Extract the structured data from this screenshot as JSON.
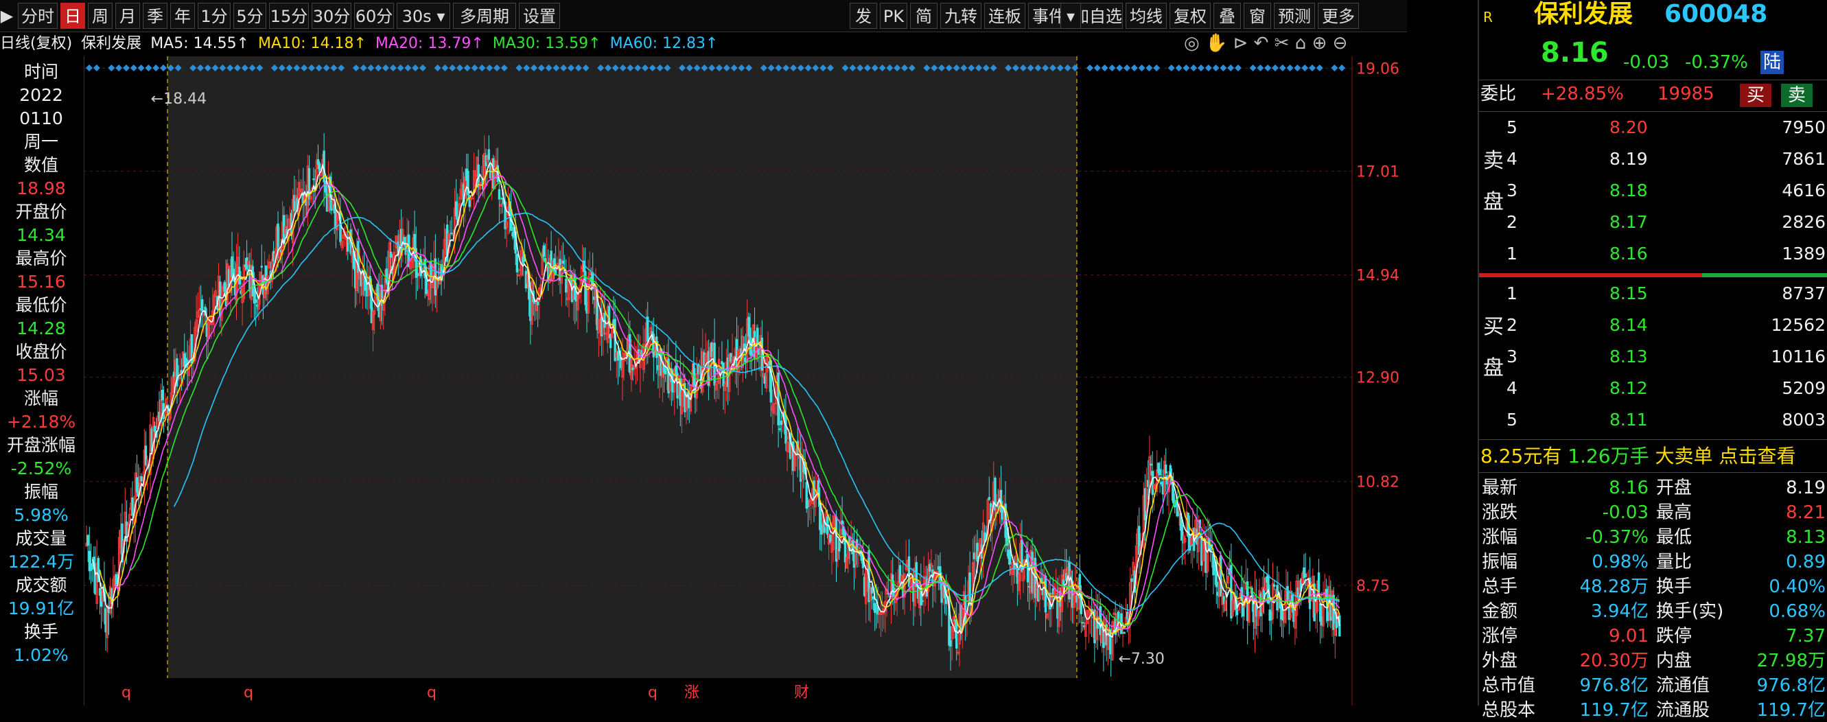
{
  "toolbar": {
    "left": [
      "分时",
      "日",
      "周",
      "月",
      "季",
      "年",
      "1分",
      "5分",
      "15分",
      "30分",
      "60分",
      "30s",
      "多周期",
      "设置"
    ],
    "active": "日",
    "right": [
      "发",
      "PK",
      "简",
      "九转",
      "连板",
      "事件",
      "加自选",
      "均线",
      "复权",
      "叠",
      "窗",
      "预测",
      "更多"
    ]
  },
  "ma_row": {
    "chart_label": "日线(复权)",
    "stock_name": "保利发展",
    "ma5": "MA5: 14.55↑",
    "ma10": "MA10: 14.18↑",
    "ma20": "MA20: 13.79↑",
    "ma30": "MA30: 13.59↑",
    "ma60": "MA60: 12.83↑"
  },
  "left_panel": [
    {
      "label": "时间",
      "value": "2022"
    },
    {
      "label": "",
      "value": "0110"
    },
    {
      "label": "周一",
      "value": ""
    },
    {
      "label": "数值",
      "value": "18.98",
      "color": "#ff3b3b"
    },
    {
      "label": "开盘价",
      "value": "14.34",
      "color": "#2ee82e"
    },
    {
      "label": "最高价",
      "value": "15.16",
      "color": "#ff3b3b"
    },
    {
      "label": "最低价",
      "value": "14.28",
      "color": "#2ee82e"
    },
    {
      "label": "收盘价",
      "value": "15.03",
      "color": "#ff3b3b"
    },
    {
      "label": "涨幅",
      "value": "+2.18%",
      "color": "#ff3b3b"
    },
    {
      "label": "开盘涨幅",
      "value": "-2.52%",
      "color": "#2ee82e"
    },
    {
      "label": "振幅",
      "value": "5.98%",
      "color": "#2ac6ff"
    },
    {
      "label": "成交量",
      "value": "122.4万",
      "color": "#2ac6ff"
    },
    {
      "label": "成交额",
      "value": "19.91亿",
      "color": "#2ac6ff"
    },
    {
      "label": "换手",
      "value": "1.02%",
      "color": "#2ac6ff"
    }
  ],
  "chart_data": {
    "type": "candlestick",
    "y_ticks": [
      "19.06",
      "17.01",
      "14.94",
      "12.90",
      "10.82",
      "8.75"
    ],
    "ylim": [
      6.9,
      19.3
    ],
    "annotations": {
      "high": "18.44",
      "low": "7.30"
    },
    "bottom_markers": [
      "q",
      "q",
      "q",
      "q",
      "涨",
      "财"
    ],
    "close_path": [
      9.6,
      8.2,
      9.8,
      11.2,
      12.4,
      13.1,
      14.0,
      14.6,
      15.0,
      14.7,
      15.8,
      16.4,
      17.2,
      15.8,
      15.0,
      14.2,
      15.6,
      15.3,
      14.8,
      16.0,
      16.8,
      17.1,
      15.8,
      14.4,
      15.3,
      14.9,
      14.6,
      13.9,
      13.3,
      13.7,
      13.0,
      12.6,
      13.2,
      12.8,
      13.7,
      13.4,
      12.2,
      11.0,
      10.1,
      9.6,
      9.2,
      8.4,
      9.0,
      8.7,
      8.9,
      7.6,
      9.0,
      10.7,
      9.3,
      9.0,
      8.3,
      8.8,
      8.0,
      7.7,
      8.2,
      10.9,
      11.0,
      9.8,
      9.4,
      8.6,
      8.4,
      8.5,
      8.3,
      8.6,
      8.4,
      8.16
    ],
    "ma_colors": {
      "ma5": "#ffffff",
      "ma10": "#ffdc00",
      "ma20": "#ff50ff",
      "ma30": "#2ee82e",
      "ma60": "#2ac6ff"
    }
  },
  "right_panel": {
    "brand_badge": "R",
    "name": "保利发展",
    "code": "600048",
    "price": "8.16",
    "change": "-0.03",
    "change_pct": "-0.37%",
    "tag": "陆",
    "weibi_label": "委比",
    "weibi_value": "+28.85%",
    "weibi_count": "19985",
    "buy_btn": "买",
    "sell_btn": "卖",
    "sell_side_label": [
      "卖",
      "盘"
    ],
    "buy_side_label": [
      "买",
      "盘"
    ],
    "asks": [
      {
        "lvl": "5",
        "price": "8.20",
        "vol": "7950",
        "color": "#ff3b3b"
      },
      {
        "lvl": "4",
        "price": "8.19",
        "vol": "7861",
        "color": "#f0f0f0"
      },
      {
        "lvl": "3",
        "price": "8.18",
        "vol": "4616",
        "color": "#2ee82e"
      },
      {
        "lvl": "2",
        "price": "8.17",
        "vol": "2826",
        "color": "#2ee82e"
      },
      {
        "lvl": "1",
        "price": "8.16",
        "vol": "1389",
        "color": "#2ee82e"
      }
    ],
    "bids": [
      {
        "lvl": "1",
        "price": "8.15",
        "vol": "8737",
        "color": "#2ee82e"
      },
      {
        "lvl": "2",
        "price": "8.14",
        "vol": "12562",
        "color": "#2ee82e"
      },
      {
        "lvl": "3",
        "price": "8.13",
        "vol": "10116",
        "color": "#2ee82e"
      },
      {
        "lvl": "4",
        "price": "8.12",
        "vol": "5209",
        "color": "#2ee82e"
      },
      {
        "lvl": "5",
        "price": "8.11",
        "vol": "8003",
        "color": "#2ee82e"
      }
    ],
    "big_order": {
      "a": "8.25元有",
      "b": "1.26万手",
      "c": "大卖单",
      "d": "点击查看"
    },
    "stats": [
      {
        "l1": "最新",
        "v1": "8.16",
        "c1": "#2ee82e",
        "l2": "开盘",
        "v2": "8.19",
        "c2": "#f0f0f0"
      },
      {
        "l1": "涨跌",
        "v1": "-0.03",
        "c1": "#2ee82e",
        "l2": "最高",
        "v2": "8.21",
        "c2": "#ff3b3b"
      },
      {
        "l1": "涨幅",
        "v1": "-0.37%",
        "c1": "#2ee82e",
        "l2": "最低",
        "v2": "8.13",
        "c2": "#2ee82e"
      },
      {
        "l1": "振幅",
        "v1": "0.98%",
        "c1": "#2ac6ff",
        "l2": "量比",
        "v2": "0.89",
        "c2": "#2ac6ff"
      },
      {
        "l1": "总手",
        "v1": "48.28万",
        "c1": "#2ac6ff",
        "l2": "换手",
        "v2": "0.40%",
        "c2": "#2ac6ff"
      },
      {
        "l1": "金额",
        "v1": "3.94亿",
        "c1": "#2ac6ff",
        "l2": "换手(实)",
        "v2": "0.68%",
        "c2": "#2ac6ff"
      },
      {
        "l1": "涨停",
        "v1": "9.01",
        "c1": "#ff3b3b",
        "l2": "跌停",
        "v2": "7.37",
        "c2": "#2ee82e"
      },
      {
        "l1": "外盘",
        "v1": "20.30万",
        "c1": "#ff3b3b",
        "l2": "内盘",
        "v2": "27.98万",
        "c2": "#2ee82e"
      },
      {
        "l1": "总市值",
        "v1": "976.8亿",
        "c1": "#2ac6ff",
        "l2": "流通值",
        "v2": "976.8亿",
        "c2": "#2ac6ff"
      },
      {
        "l1": "总股本",
        "v1": "119.7亿",
        "c1": "#2ac6ff",
        "l2": "流通股",
        "v2": "119.7亿",
        "c2": "#2ac6ff"
      }
    ]
  }
}
